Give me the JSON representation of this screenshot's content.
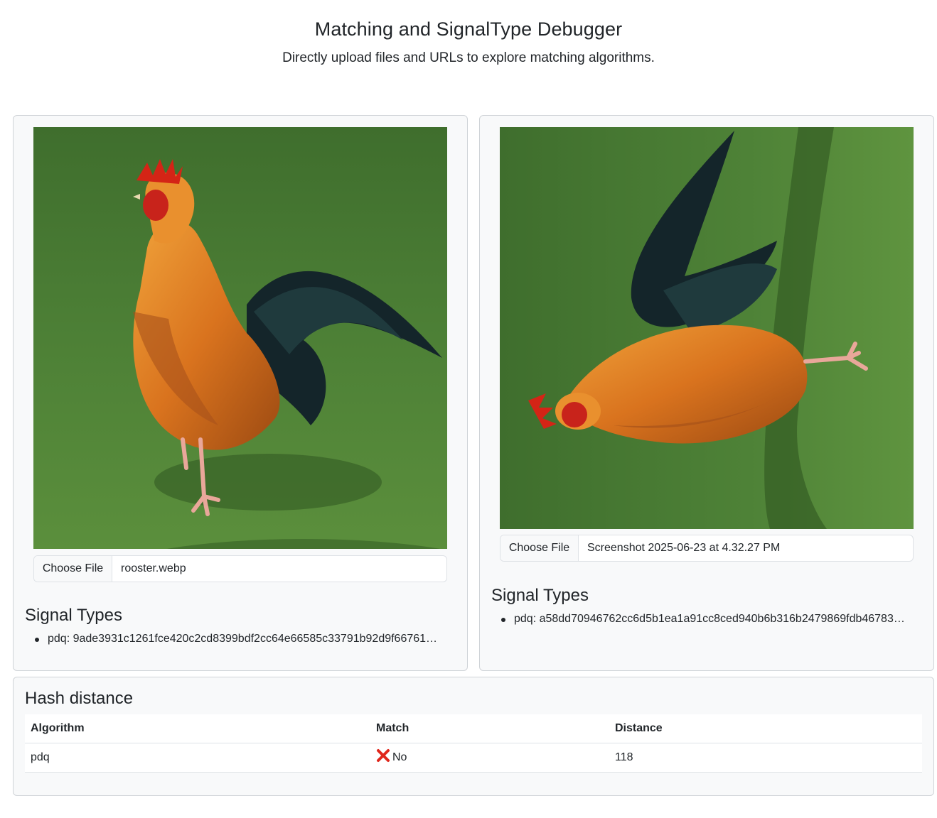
{
  "header": {
    "title": "Matching and SignalType Debugger",
    "subtitle": "Directly upload files and URLs to explore matching algorithms."
  },
  "left_panel": {
    "image_icon": "rooster-standing-photo",
    "file_button": "Choose File",
    "file_name": "rooster.webp",
    "signal_types_title": "Signal Types",
    "signals": [
      "pdq: 9ade3931c1261fce420c2cd8399bdf2cc64e66585c33791b92d9f66761…"
    ]
  },
  "right_panel": {
    "image_icon": "rooster-rotated-photo",
    "file_button": "Choose File",
    "file_name": "Screenshot 2025-06-23 at 4.32.27 PM",
    "signal_types_title": "Signal Types",
    "signals": [
      "pdq: a58dd70946762cc6d5b1ea1a91cc8ced940b6b316b2479869fdb46783…"
    ]
  },
  "hash_distance": {
    "title": "Hash distance",
    "columns": [
      "Algorithm",
      "Match",
      "Distance"
    ],
    "rows": [
      {
        "algorithm": "pdq",
        "match": "No",
        "match_icon": "cross-mark-icon",
        "distance": "118"
      }
    ]
  },
  "colors": {
    "card_bg": "#f8f9fa",
    "border": "#dee2e6",
    "grass": "#4a7a32",
    "cross": "#e0261b"
  }
}
